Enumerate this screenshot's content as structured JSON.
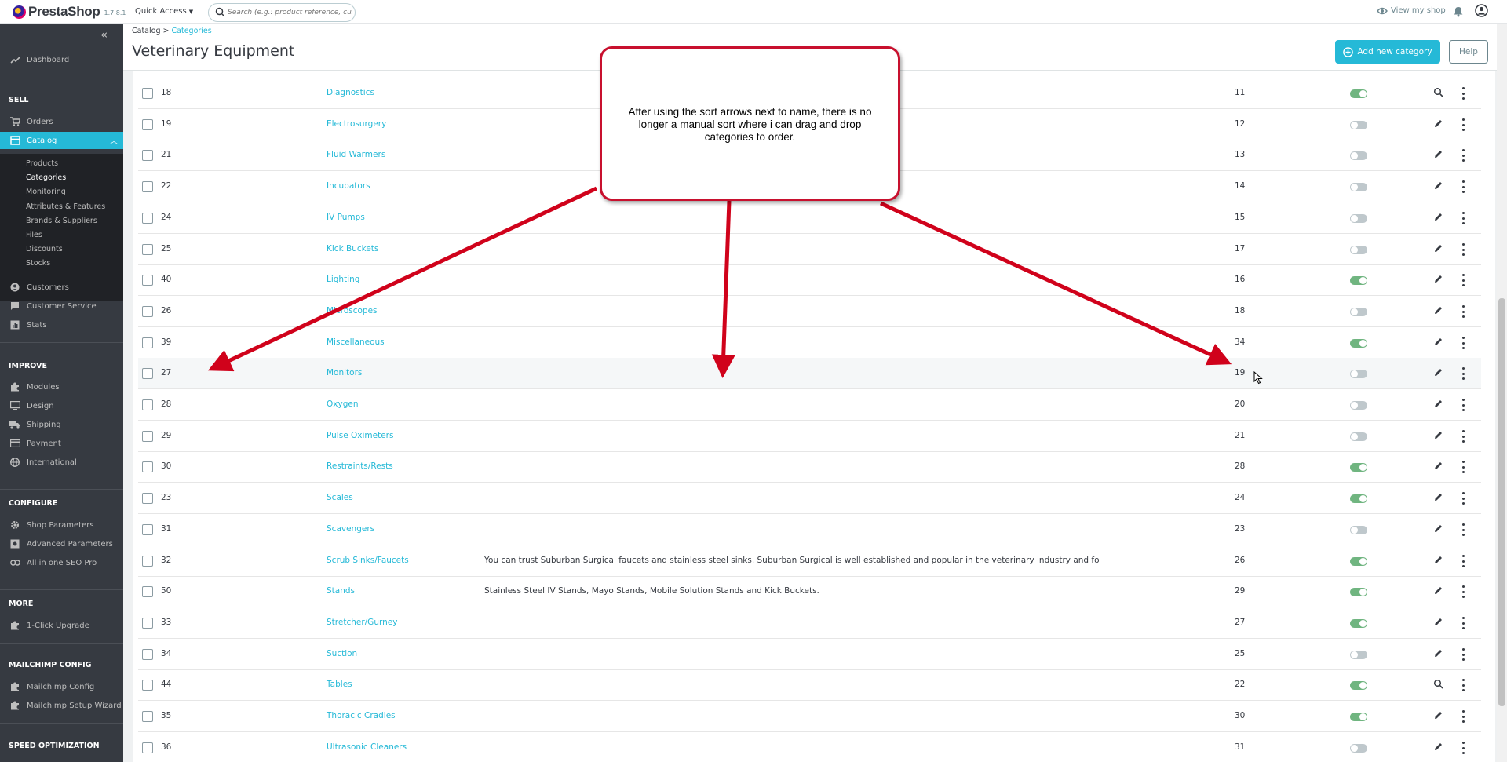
{
  "topbar": {
    "brand": "PrestaShop",
    "version": "1.7.8.1",
    "quick_access": "Quick Access",
    "search_placeholder": "Search (e.g.: product reference, custon",
    "view_shop": "View my shop"
  },
  "sidebar": {
    "dashboard": "Dashboard",
    "sections": {
      "sell": "SELL",
      "improve": "IMPROVE",
      "configure": "CONFIGURE",
      "more": "MORE",
      "mailchimp": "MAILCHIMP CONFIG",
      "speed": "SPEED OPTIMIZATION"
    },
    "sell_items": [
      "Orders",
      "Catalog"
    ],
    "catalog_sub": [
      "Products",
      "Categories",
      "Monitoring",
      "Attributes & Features",
      "Brands & Suppliers",
      "Files",
      "Discounts",
      "Stocks"
    ],
    "sell_items_after": [
      "Customers",
      "Customer Service",
      "Stats"
    ],
    "improve_items": [
      "Modules",
      "Design",
      "Shipping",
      "Payment",
      "International"
    ],
    "configure_items": [
      "Shop Parameters",
      "Advanced Parameters",
      "All in one SEO Pro"
    ],
    "more_items": [
      "1-Click Upgrade"
    ],
    "mailchimp_items": [
      "Mailchimp Config",
      "Mailchimp Setup Wizard"
    ]
  },
  "header": {
    "breadcrumb_parent": "Catalog",
    "breadcrumb_sep": ">",
    "breadcrumb_current": "Categories",
    "title": "Veterinary Equipment",
    "add_button": "Add new category",
    "help_button": "Help"
  },
  "rows": [
    {
      "id": "18",
      "name": "Diagnostics",
      "desc": "",
      "pos": "11",
      "enabled": true,
      "action": "view"
    },
    {
      "id": "19",
      "name": "Electrosurgery",
      "desc": "",
      "pos": "12",
      "enabled": false,
      "action": "edit"
    },
    {
      "id": "21",
      "name": "Fluid Warmers",
      "desc": "",
      "pos": "13",
      "enabled": false,
      "action": "edit"
    },
    {
      "id": "22",
      "name": "Incubators",
      "desc": "",
      "pos": "14",
      "enabled": false,
      "action": "edit"
    },
    {
      "id": "24",
      "name": "IV Pumps",
      "desc": "",
      "pos": "15",
      "enabled": false,
      "action": "edit"
    },
    {
      "id": "25",
      "name": "Kick Buckets",
      "desc": "",
      "pos": "17",
      "enabled": false,
      "action": "edit"
    },
    {
      "id": "40",
      "name": "Lighting",
      "desc": "",
      "pos": "16",
      "enabled": true,
      "action": "edit"
    },
    {
      "id": "26",
      "name": "Microscopes",
      "desc": "",
      "pos": "18",
      "enabled": false,
      "action": "edit"
    },
    {
      "id": "39",
      "name": "Miscellaneous",
      "desc": "",
      "pos": "34",
      "enabled": true,
      "action": "edit"
    },
    {
      "id": "27",
      "name": "Monitors",
      "desc": "",
      "pos": "19",
      "enabled": false,
      "action": "edit"
    },
    {
      "id": "28",
      "name": "Oxygen",
      "desc": "",
      "pos": "20",
      "enabled": false,
      "action": "edit"
    },
    {
      "id": "29",
      "name": "Pulse Oximeters",
      "desc": "",
      "pos": "21",
      "enabled": false,
      "action": "edit"
    },
    {
      "id": "30",
      "name": "Restraints/Rests",
      "desc": "",
      "pos": "28",
      "enabled": true,
      "action": "edit"
    },
    {
      "id": "23",
      "name": "Scales",
      "desc": "",
      "pos": "24",
      "enabled": true,
      "action": "edit"
    },
    {
      "id": "31",
      "name": "Scavengers",
      "desc": "",
      "pos": "23",
      "enabled": false,
      "action": "edit"
    },
    {
      "id": "32",
      "name": "Scrub Sinks/Faucets",
      "desc": "You can trust Suburban Surgical faucets and stainless steel sinks. Suburban Surgical is well established and popular in the veterinary industry and fo",
      "pos": "26",
      "enabled": true,
      "action": "edit"
    },
    {
      "id": "50",
      "name": "Stands",
      "desc": "Stainless Steel IV Stands, Mayo Stands, Mobile Solution Stands and Kick Buckets.",
      "pos": "29",
      "enabled": true,
      "action": "edit"
    },
    {
      "id": "33",
      "name": "Stretcher/Gurney",
      "desc": "",
      "pos": "27",
      "enabled": true,
      "action": "edit"
    },
    {
      "id": "34",
      "name": "Suction",
      "desc": "",
      "pos": "25",
      "enabled": false,
      "action": "edit"
    },
    {
      "id": "44",
      "name": "Tables",
      "desc": "",
      "pos": "22",
      "enabled": true,
      "action": "view"
    },
    {
      "id": "35",
      "name": "Thoracic Cradles",
      "desc": "",
      "pos": "30",
      "enabled": true,
      "action": "edit"
    },
    {
      "id": "36",
      "name": "Ultrasonic Cleaners",
      "desc": "",
      "pos": "31",
      "enabled": false,
      "action": "edit"
    }
  ],
  "annotation": {
    "text": "After using the sort arrows next to name, there is no longer a manual sort where i can drag and drop categories to order."
  },
  "colors": {
    "accent": "#25b9d7",
    "sidebar": "#363a41",
    "toggle_on": "#70b580",
    "annotation_red": "#d0021b"
  }
}
